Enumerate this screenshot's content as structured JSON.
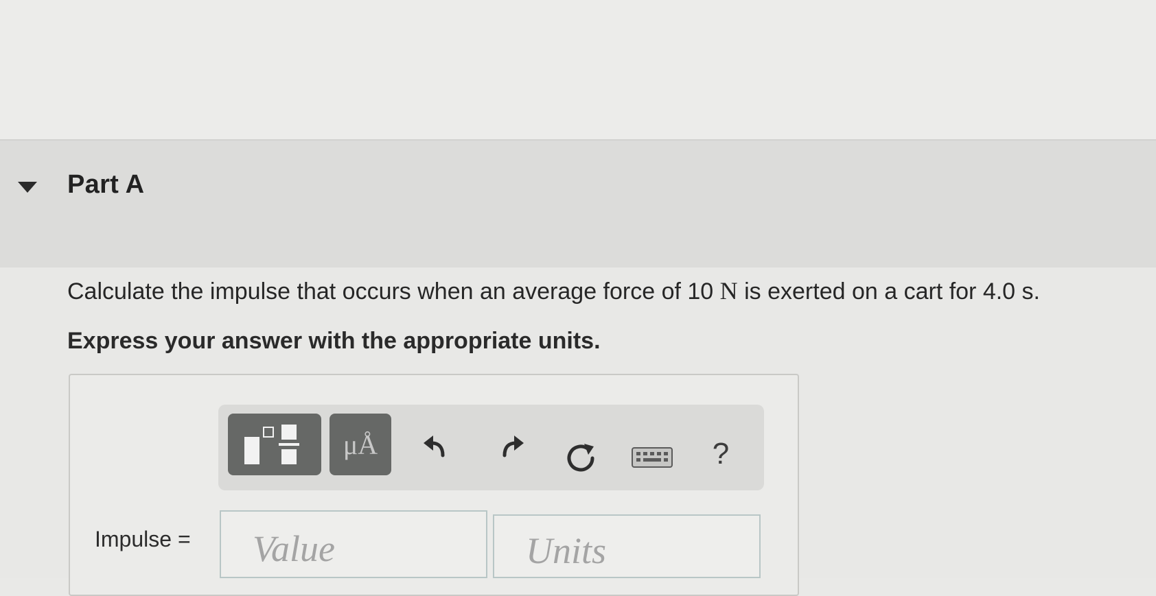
{
  "part": {
    "title": "Part A"
  },
  "question": {
    "text_before": "Calculate the impulse that occurs when an average force of 10 ",
    "force_unit": "N",
    "text_after": " is exerted on a cart for 4.0 s."
  },
  "instruction": "Express your answer with the appropriate units.",
  "toolbar": {
    "units_label": "μÅ",
    "help_label": "?"
  },
  "answer": {
    "label": "Impulse =",
    "value_placeholder": "Value",
    "units_placeholder": "Units"
  },
  "icons": {
    "collapse": "caret-down-icon",
    "templates": "templates-icon",
    "undo": "undo-icon",
    "redo": "redo-icon",
    "reset": "reset-icon",
    "keyboard": "keyboard-icon"
  },
  "colors": {
    "header_band": "#dcdcda",
    "toolbar_button": "#666866",
    "field_border": "#b8c6c6"
  }
}
